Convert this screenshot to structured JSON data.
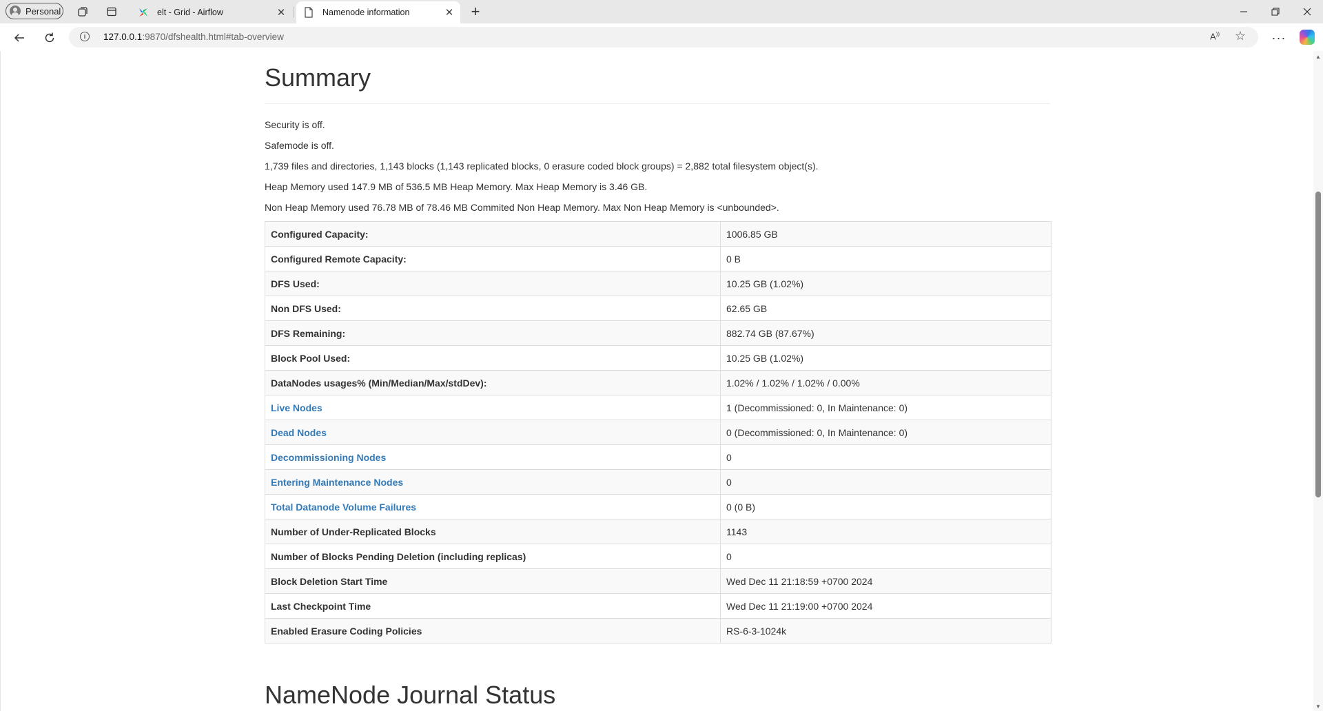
{
  "browser": {
    "profile_label": "Personal",
    "tabs": [
      {
        "title": "elt - Grid - Airflow"
      },
      {
        "title": "Namenode information"
      }
    ],
    "url_host": "127.0.0.1",
    "url_rest": ":9870/dfshealth.html#tab-overview"
  },
  "page": {
    "summary_title": "Summary",
    "security": "Security is off.",
    "safemode": "Safemode is off.",
    "objects": "1,739 files and directories, 1,143 blocks (1,143 replicated blocks, 0 erasure coded block groups) = 2,882 total filesystem object(s).",
    "heap": "Heap Memory used 147.9 MB of 536.5 MB Heap Memory. Max Heap Memory is 3.46 GB.",
    "nonheap": "Non Heap Memory used 76.78 MB of 78.46 MB Commited Non Heap Memory. Max Non Heap Memory is <unbounded>.",
    "rows": [
      {
        "key": "Configured Capacity:",
        "value": "1006.85 GB"
      },
      {
        "key": "Configured Remote Capacity:",
        "value": "0 B"
      },
      {
        "key": "DFS Used:",
        "value": "10.25 GB (1.02%)"
      },
      {
        "key": "Non DFS Used:",
        "value": "62.65 GB"
      },
      {
        "key": "DFS Remaining:",
        "value": "882.74 GB (87.67%)"
      },
      {
        "key": "Block Pool Used:",
        "value": "10.25 GB (1.02%)"
      },
      {
        "key": "DataNodes usages% (Min/Median/Max/stdDev):",
        "value": "1.02% / 1.02% / 1.02% / 0.00%"
      },
      {
        "key": "Live Nodes",
        "value": "1 (Decommissioned: 0, In Maintenance: 0)"
      },
      {
        "key": "Dead Nodes",
        "value": "0 (Decommissioned: 0, In Maintenance: 0)"
      },
      {
        "key": "Decommissioning Nodes",
        "value": "0"
      },
      {
        "key": "Entering Maintenance Nodes",
        "value": "0"
      },
      {
        "key": "Total Datanode Volume Failures",
        "value": "0 (0 B)"
      },
      {
        "key": "Number of Under-Replicated Blocks",
        "value": "1143"
      },
      {
        "key": "Number of Blocks Pending Deletion (including replicas)",
        "value": "0"
      },
      {
        "key": "Block Deletion Start Time",
        "value": "Wed Dec 11 21:18:59 +0700 2024"
      },
      {
        "key": "Last Checkpoint Time",
        "value": "Wed Dec 11 21:19:00 +0700 2024"
      },
      {
        "key": "Enabled Erasure Coding Policies",
        "value": "RS-6-3-1024k"
      }
    ],
    "journal_title": "NameNode Journal Status"
  },
  "colors": {
    "link": "#337ab7",
    "text": "#333333",
    "row_stripe": "#f9f9f9",
    "border": "#dddddd"
  }
}
